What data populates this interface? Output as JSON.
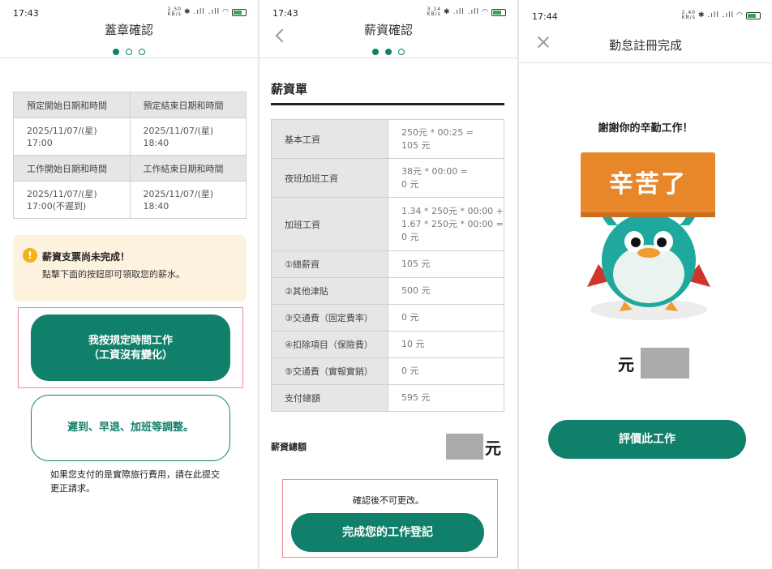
{
  "screens": [
    {
      "status": {
        "time": "17:43",
        "speed": "2.50\nKB/s"
      },
      "title": "蓋章確認",
      "table": [
        {
          "h1": "預定開始日期和時間",
          "h2": "預定結束日期和時間",
          "v1": "2025/11/07/(星)\n17:00",
          "v2": "2025/11/07/(星)\n18:40"
        },
        {
          "h1": "工作開始日期和時間",
          "h2": "工作結束日期和時間",
          "v1": "2025/11/07/(星)\n17:00(不遲到)",
          "v2": "2025/11/07/(星)\n18:40"
        }
      ],
      "notice": {
        "icon": "!",
        "title": "薪資支票尚未完成！",
        "body": "點擊下面的按鈕即可領取您的薪水。"
      },
      "primary_button": "我按規定時間工作\n（工資沒有變化）",
      "secondary_button": "遲到、早退、加班等調整。",
      "note": "如果您支付的是實際旅行費用，請在此提交更正請求。"
    },
    {
      "status": {
        "time": "17:43",
        "speed": "3.14\nKB/s"
      },
      "title": "薪資確認",
      "section_title": "薪資單",
      "rows": [
        {
          "k": "基本工資",
          "v": "250元 * 00:25 =\n105 元"
        },
        {
          "k": "夜班加班工資",
          "v": "38元 * 00:00 =\n0 元"
        },
        {
          "k": "加班工資",
          "v": "1.34 * 250元 * 00:00 +\n1.67 * 250元 * 00:00 =\n0 元"
        },
        {
          "k": "①總薪資",
          "v": "105 元"
        },
        {
          "k": "②其他津貼",
          "v": "500 元"
        },
        {
          "k": "③交通費（固定費率）",
          "v": "0 元"
        },
        {
          "k": "④扣除項目（保險費）",
          "v": "10 元"
        },
        {
          "k": "⑤交通費（實報實銷）",
          "v": "0 元"
        },
        {
          "k": "支付總額",
          "v": "595 元"
        }
      ],
      "total_label": "薪資總額",
      "currency": "元",
      "confirm_note": "確認後不可更改。",
      "button": "完成您的工作登記"
    },
    {
      "status": {
        "time": "17:44",
        "speed": "2.40\nKB/s"
      },
      "title": "勤怠註冊完成",
      "thanks": "謝謝你的辛勤工作！",
      "sign_text": "辛苦了",
      "currency": "元",
      "button": "評價此工作"
    }
  ],
  "colors": {
    "brand": "#11806a",
    "highlight": "#ef8a94",
    "notice_bg": "#fdf2de",
    "sign": "#e8862a",
    "mascot": "#1fa99e"
  },
  "icons": [
    "bluetooth-icon",
    "signal-icon",
    "wifi-icon",
    "battery-icon",
    "back-chevron-icon",
    "close-icon",
    "warning-icon"
  ]
}
